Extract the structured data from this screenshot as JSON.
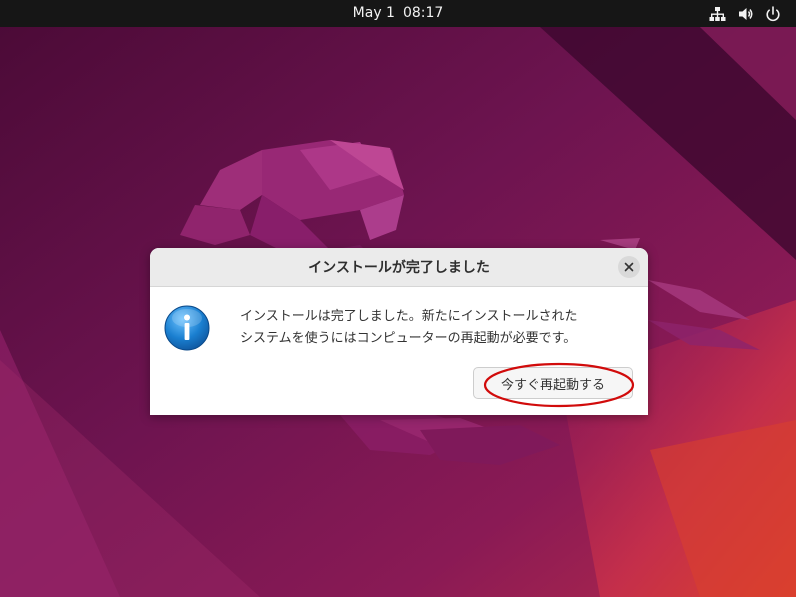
{
  "topbar": {
    "date": "May 1",
    "time": "08:17",
    "icons": [
      "network-icon",
      "volume-icon",
      "power-icon"
    ]
  },
  "dialog": {
    "title": "インストールが完了しました",
    "message_line1": "インストールは完了しました。新たにインストールされた",
    "message_line2": "システムを使うにはコンピューターの再起動が必要です。",
    "restart_label": "今すぐ再起動する",
    "icon": "info-icon"
  },
  "colors": {
    "topbar_bg": "#161616",
    "dialog_header_bg": "#ebebeb",
    "info_icon_blue": "#1a7fd0",
    "highlight_red": "#d10b0b",
    "wallpaper_base": "#6e1450",
    "wallpaper_orange": "#e0432a"
  }
}
